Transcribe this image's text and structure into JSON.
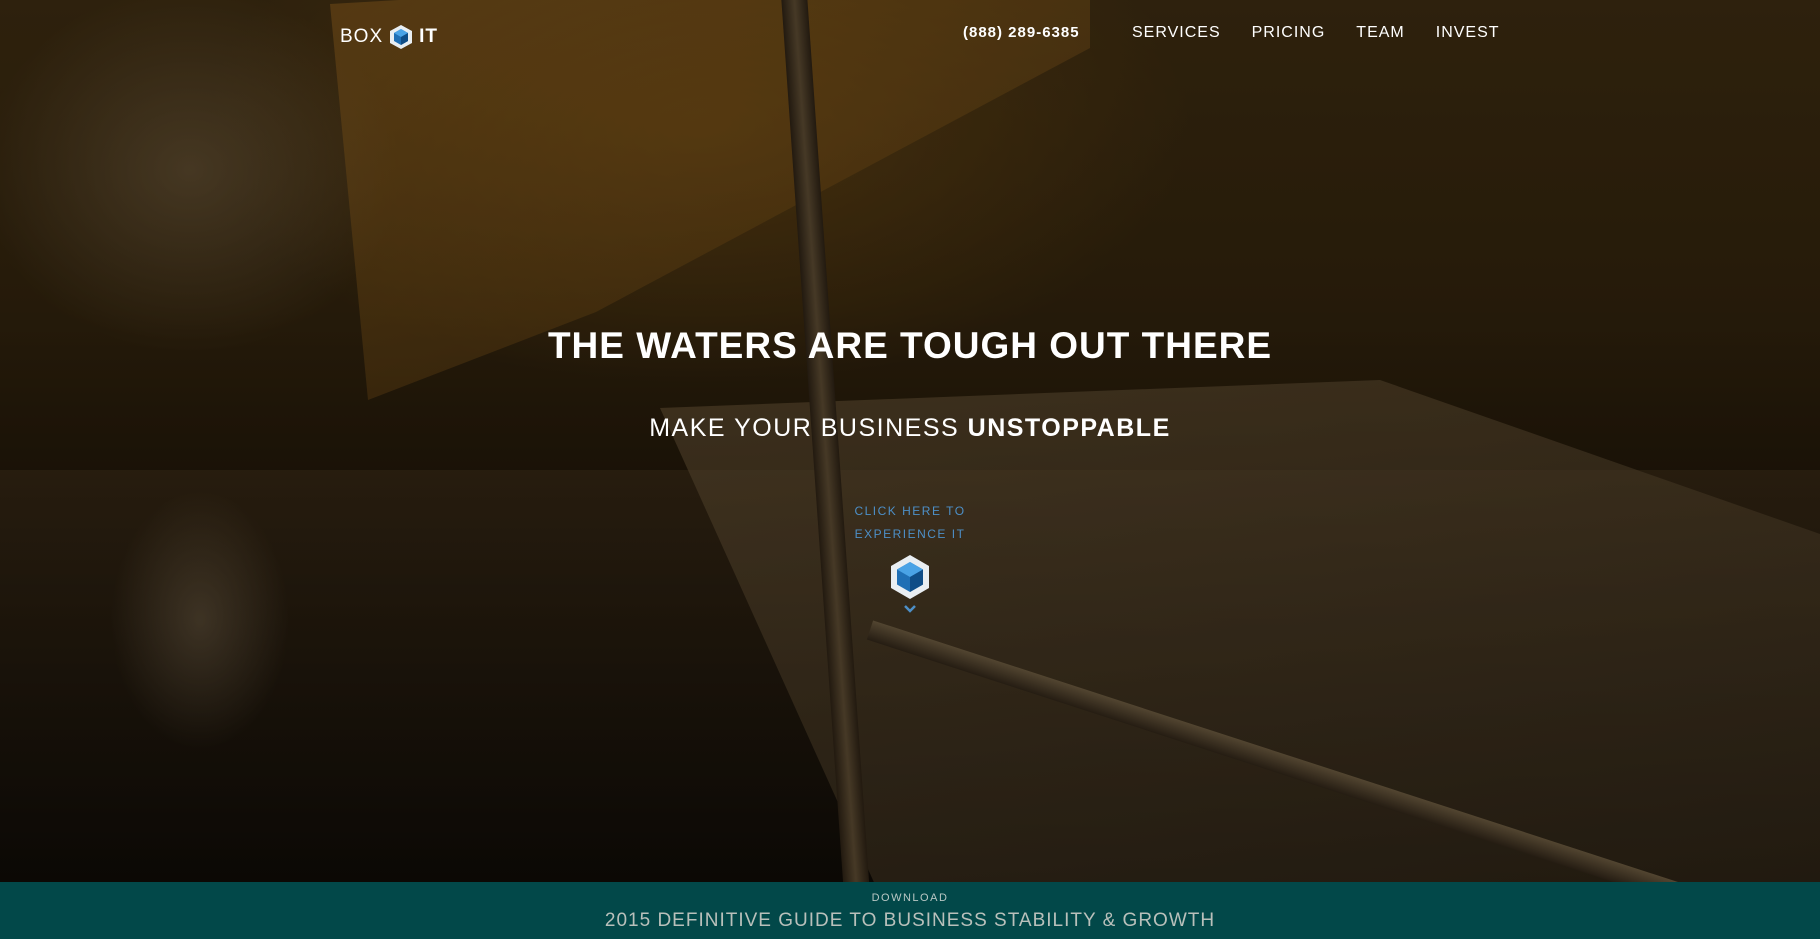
{
  "header": {
    "logo": {
      "word1": "BOX",
      "word2": "IT",
      "icon": "hexagon-cube-icon"
    },
    "phone": "(888) 289-6385",
    "nav": [
      {
        "label": "SERVICES"
      },
      {
        "label": "PRICING"
      },
      {
        "label": "TEAM"
      },
      {
        "label": "INVEST"
      }
    ]
  },
  "hero": {
    "headline": "THE WATERS ARE TOUGH OUT THERE",
    "subline_regular": "MAKE YOUR BUSINESS ",
    "subline_bold": "UNSTOPPABLE",
    "cta": {
      "line1": "CLICK HERE TO",
      "line2": "EXPERIENCE IT",
      "icon": "hexagon-cube-icon",
      "arrow_icon": "chevron-down-icon"
    }
  },
  "banner": {
    "small": "DOWNLOAD",
    "big": "2015 DEFINITIVE GUIDE TO BUSINESS STABILITY & GROWTH"
  },
  "colors": {
    "accent_blue": "#4d8fc7",
    "banner_bg": "#024849"
  }
}
